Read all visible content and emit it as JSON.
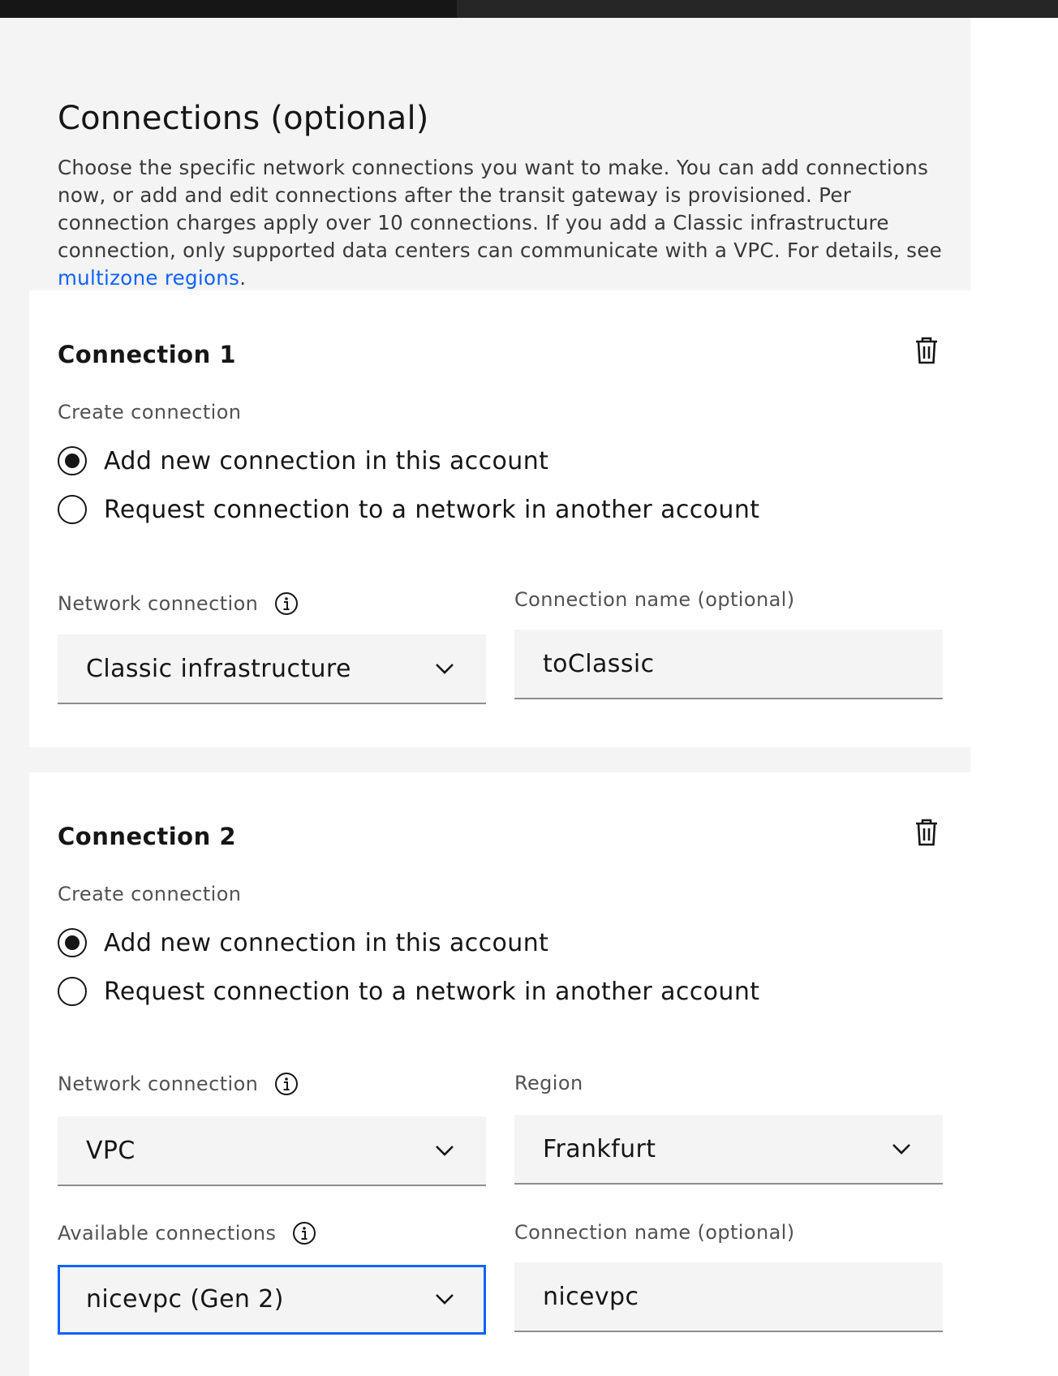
{
  "page": {
    "heading": "Connections (optional)",
    "intro_text": "Choose the specific network connections you want to make. You can add connections now, or add and edit connections after the transit gateway is provisioned. Per connection charges apply over 10 connections. If you add a Classic infrastructure connection, only supported data centers can communicate with a VPC. For details, see ",
    "intro_link": "multizone regions",
    "intro_end": ".",
    "progress_fraction": 0.432
  },
  "connections": [
    {
      "title": "Connection 1",
      "create_label": "Create connection",
      "radio_options": [
        {
          "label": "Add new connection in this account",
          "checked": true
        },
        {
          "label": "Request connection to a network in another account",
          "checked": false
        }
      ],
      "network_label": "Network connection",
      "network_value": "Classic infrastructure",
      "name_label": "Connection name (optional)",
      "name_value": "toClassic"
    },
    {
      "title": "Connection 2",
      "create_label": "Create connection",
      "radio_options": [
        {
          "label": "Add new connection in this account",
          "checked": true
        },
        {
          "label": "Request connection to a network in another account",
          "checked": false
        }
      ],
      "network_label": "Network connection",
      "network_value": "VPC",
      "region_label": "Region",
      "region_value": "Frankfurt",
      "available_label": "Available connections",
      "available_value": "nicevpc (Gen 2)",
      "name_label": "Connection name (optional)",
      "name_value": "nicevpc"
    }
  ],
  "icons": {
    "delete": "trash-can-icon",
    "info": "information-icon",
    "dropdown": "chevron-down-icon"
  },
  "colors": {
    "link": "#0f62fe",
    "focus": "#0f62fe",
    "background": "#f4f4f4",
    "card": "#ffffff"
  }
}
